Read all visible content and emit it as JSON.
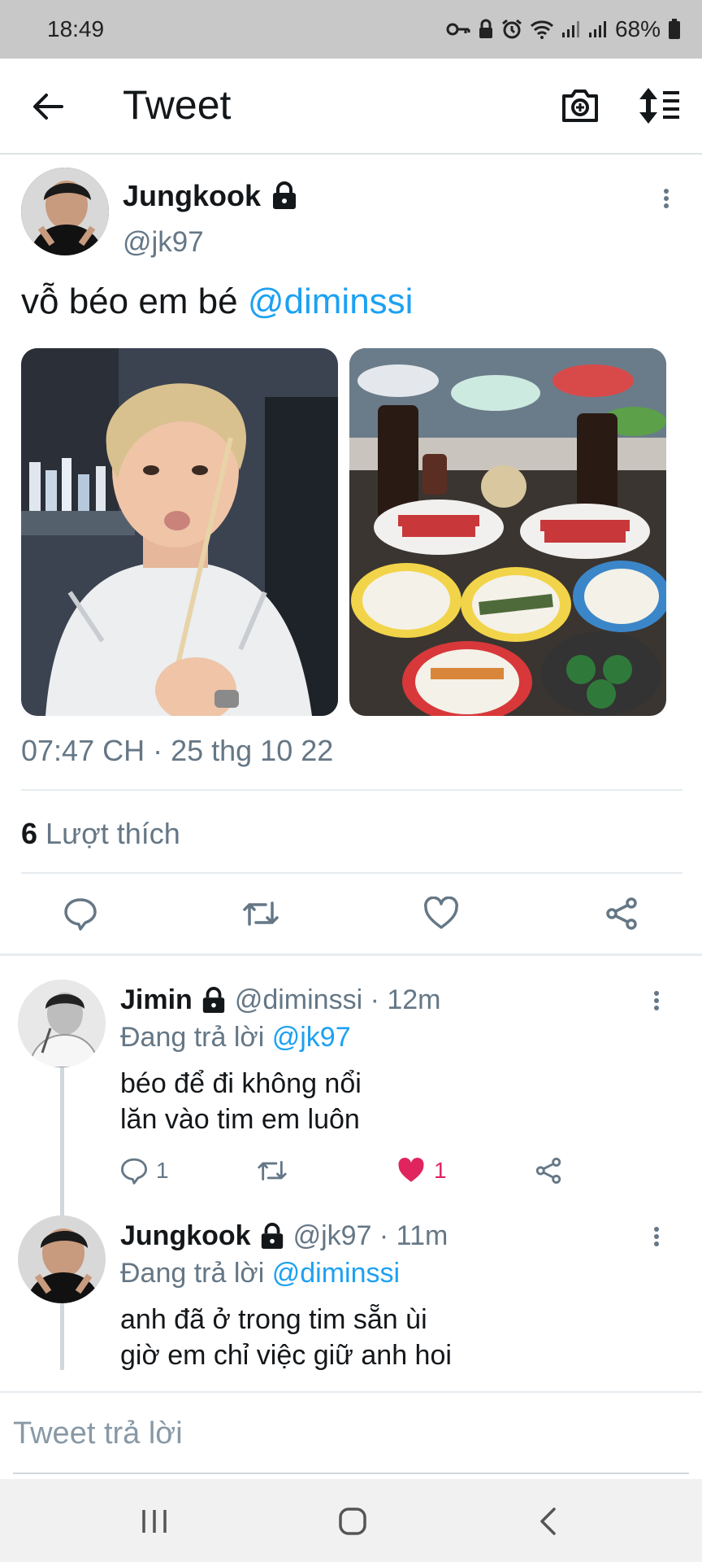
{
  "status_bar": {
    "time": "18:49",
    "battery": "68%",
    "icons": [
      "key-icon",
      "lock-icon",
      "alarm-icon",
      "wifi-icon",
      "signal-icon",
      "signal-icon",
      "battery-icon"
    ]
  },
  "header": {
    "title": "Tweet",
    "back_icon": "arrow-left-icon",
    "camera_icon": "camera-plus-icon",
    "sort_icon": "sort-icon"
  },
  "tweet": {
    "author_name": "Jungkook",
    "author_handle": "@jk97",
    "text_prefix": "vỗ béo em bé ",
    "text_mention": "@diminssi",
    "timestamp": "07:47 CH · 25 thg 10 22",
    "likes_count": "6",
    "likes_label": "Lượt thích",
    "actions": [
      "reply-icon",
      "retweet-icon",
      "like-icon",
      "share-icon"
    ]
  },
  "replies": [
    {
      "name": "Jimin",
      "handle_time": "@diminssi · 12m",
      "replying_label": "Đang trả lời",
      "replying_to": "@jk97",
      "lines": [
        "béo để đi không nổi",
        "lăn vào tim em luôn"
      ],
      "reply_count": "1",
      "like_count": "1",
      "liked": true
    },
    {
      "name": "Jungkook",
      "handle_time": "@jk97 · 11m",
      "replying_label": "Đang trả lời",
      "replying_to": "@diminssi",
      "lines": [
        "anh đã ở trong tim sẵn ùi",
        "giờ em chỉ việc giữ anh hoi"
      ]
    }
  ],
  "composer": {
    "placeholder": "Tweet trả lời"
  },
  "colors": {
    "accent": "#1da1f2",
    "like": "#e0245e",
    "muted": "#657786",
    "status_bar_bg": "#c8c8c8"
  }
}
